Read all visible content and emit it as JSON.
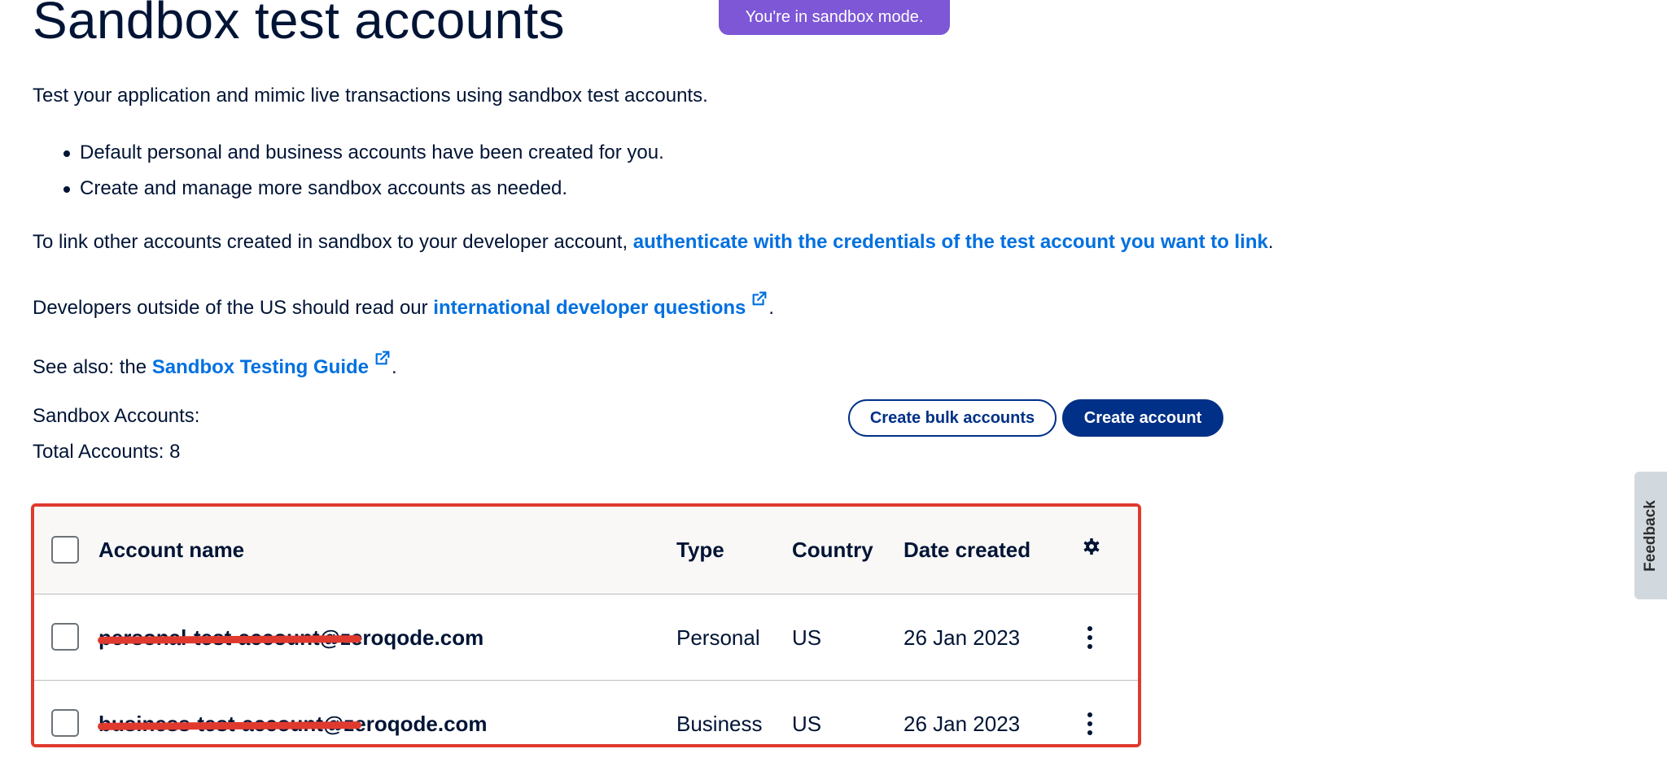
{
  "page": {
    "title": "Sandbox test accounts",
    "sandbox_badge": "You're in sandbox mode.",
    "intro": "Test your application and mimic live transactions using sandbox test accounts.",
    "bullets": [
      "Default personal and business accounts have been created for you.",
      "Create and manage more sandbox accounts as needed."
    ],
    "link_line": {
      "prefix": "To link other accounts created in sandbox to your developer account, ",
      "link": "authenticate with the credentials of the test account you want to link",
      "suffix": "."
    },
    "intl_line": {
      "prefix": "Developers outside of the US should read our ",
      "link": "international developer questions",
      "suffix": "."
    },
    "see_also": {
      "prefix": "See also: the ",
      "link": "Sandbox Testing Guide",
      "suffix": "."
    },
    "accounts_label": "Sandbox Accounts:",
    "total_label": "Total Accounts: 8",
    "buttons": {
      "bulk": "Create bulk accounts",
      "create": "Create account"
    }
  },
  "table": {
    "headers": {
      "name": "Account name",
      "type": "Type",
      "country": "Country",
      "date": "Date created"
    },
    "rows": [
      {
        "name": "personal-test-account@zeroqode.com",
        "type": "Personal",
        "country": "US",
        "date": "26 Jan 2023"
      },
      {
        "name": "business-test-account@zeroqode.com",
        "type": "Business",
        "country": "US",
        "date": "26 Jan 2023"
      }
    ]
  },
  "feedback": "Feedback",
  "icons": {
    "settings": "gear-icon",
    "row_menu": "kebab-menu-icon",
    "external": "external-link-icon"
  },
  "colors": {
    "navy": "#001435",
    "primary_button": "#003087",
    "link": "#0070e0",
    "badge": "#7d57d6",
    "highlight_border": "#e03a2f"
  }
}
